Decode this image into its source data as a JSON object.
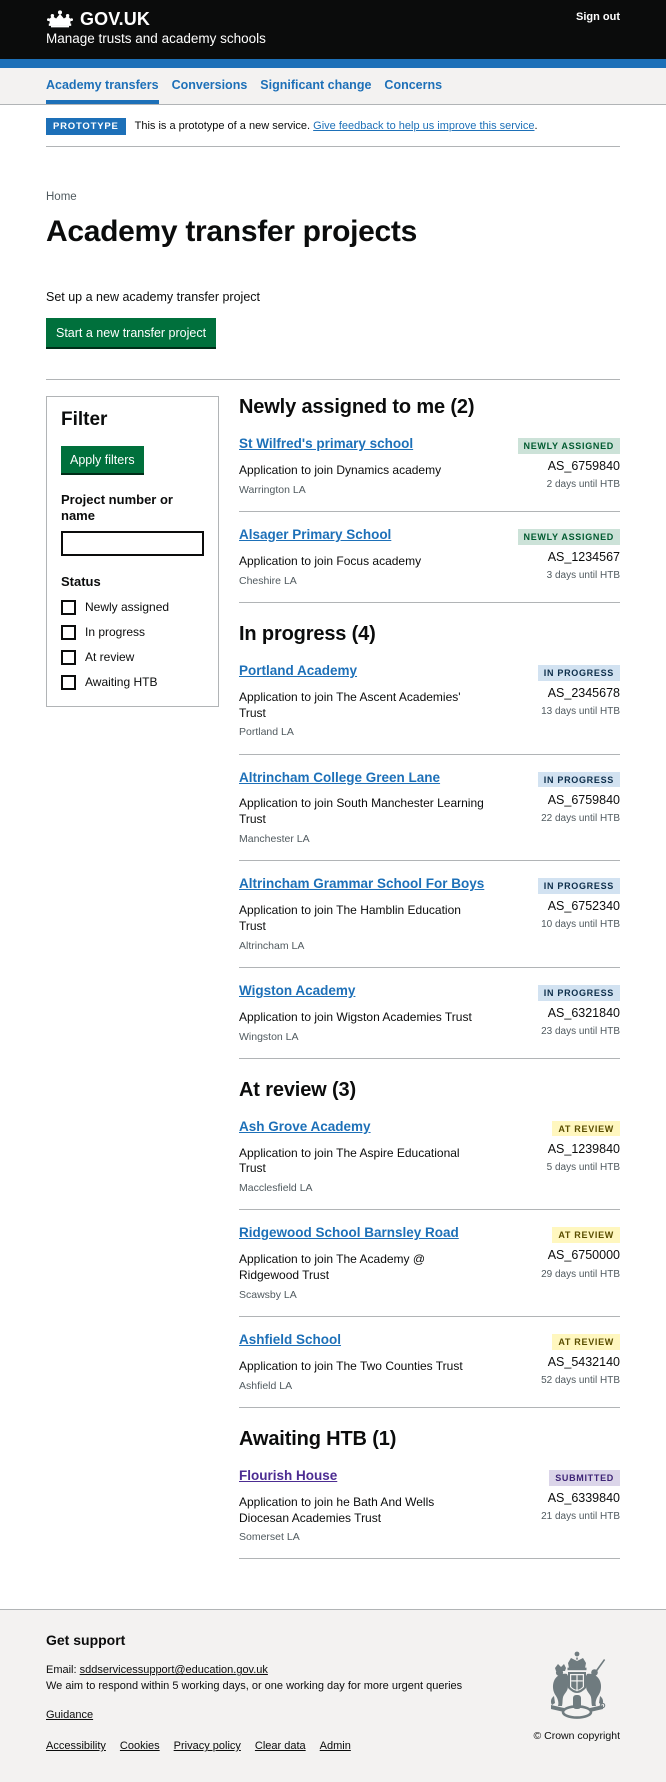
{
  "header": {
    "brand": "GOV.UK",
    "service_name": "Manage trusts and academy schools",
    "sign_out": "Sign out",
    "crown_icon": "crown-icon"
  },
  "nav": {
    "items": [
      {
        "label": "Academy transfers",
        "active": true
      },
      {
        "label": "Conversions",
        "active": false
      },
      {
        "label": "Significant change",
        "active": false
      },
      {
        "label": "Concerns",
        "active": false
      }
    ]
  },
  "phase_banner": {
    "tag": "PROTOTYPE",
    "text": "This is a prototype of a new service.",
    "link": "Give feedback to help us improve this service",
    "trailing": "."
  },
  "breadcrumb": "Home",
  "page_title": "Academy transfer projects",
  "intro": {
    "text": "Set up a new academy transfer project",
    "start_button": "Start a new transfer project"
  },
  "filter": {
    "title": "Filter",
    "apply_label": "Apply filters",
    "project_label": "Project number or name",
    "project_value": "",
    "project_placeholder": "",
    "status_label": "Status",
    "status_options": [
      {
        "label": "Newly assigned",
        "checked": false
      },
      {
        "label": "In progress",
        "checked": false
      },
      {
        "label": "At review",
        "checked": false
      },
      {
        "label": "Awaiting HTB",
        "checked": false
      }
    ]
  },
  "sections": [
    {
      "title": "Newly assigned to me (2)",
      "projects": [
        {
          "name": "St Wilfred's primary school",
          "description": "Application to join Dynamics academy",
          "la": "Warrington LA",
          "status": "NEWLY ASSIGNED",
          "status_style": "tag-green",
          "reference": "AS_6759840",
          "due": "2 days until HTB"
        },
        {
          "name": "Alsager Primary School",
          "description": "Application to join Focus academy",
          "la": "Cheshire LA",
          "status": "NEWLY ASSIGNED",
          "status_style": "tag-green",
          "reference": "AS_1234567",
          "due": "3 days until HTB"
        }
      ]
    },
    {
      "title": "In progress (4)",
      "projects": [
        {
          "name": "Portland Academy",
          "description": "Application to join The Ascent Academies' Trust",
          "la": "Portland LA",
          "status": "IN PROGRESS",
          "status_style": "tag-blue",
          "reference": "AS_2345678",
          "due": "13 days until HTB"
        },
        {
          "name": "Altrincham College Green Lane",
          "description": "Application to join South Manchester Learning Trust",
          "la": "Manchester LA",
          "status": "IN PROGRESS",
          "status_style": "tag-blue",
          "reference": "AS_6759840",
          "due": "22 days until HTB"
        },
        {
          "name": "Altrincham Grammar School For Boys",
          "description": "Application to join The Hamblin Education Trust",
          "la": "Altrincham LA",
          "status": "IN PROGRESS",
          "status_style": "tag-blue",
          "reference": "AS_6752340",
          "due": "10 days until HTB"
        },
        {
          "name": "Wigston Academy",
          "description": "Application to join Wigston Academies Trust",
          "la": "Wingston LA",
          "status": "IN PROGRESS",
          "status_style": "tag-blue",
          "reference": "AS_6321840",
          "due": "23 days until HTB"
        }
      ]
    },
    {
      "title": "At review (3)",
      "projects": [
        {
          "name": "Ash Grove Academy",
          "description": "Application to join The Aspire Educational Trust",
          "la": "Macclesfield LA",
          "status": "AT REVIEW",
          "status_style": "tag-yellow",
          "reference": "AS_1239840",
          "due": "5 days until HTB"
        },
        {
          "name": "Ridgewood School Barnsley Road",
          "description": "Application to join The Academy @ Ridgewood Trust",
          "la": "Scawsby LA",
          "status": "AT REVIEW",
          "status_style": "tag-yellow",
          "reference": "AS_6750000",
          "due": "29 days until HTB"
        },
        {
          "name": "Ashfield School",
          "description": "Application to join The Two Counties Trust",
          "la": "Ashfield LA",
          "status": "AT REVIEW",
          "status_style": "tag-yellow",
          "reference": "AS_5432140",
          "due": "52 days until HTB"
        }
      ]
    },
    {
      "title": "Awaiting HTB (1)",
      "projects": [
        {
          "name": "Flourish House",
          "description": "Application to join he Bath And Wells Diocesan Academies Trust",
          "la": "Somerset LA",
          "status": "SUBMITTED",
          "status_style": "tag-purple",
          "reference": "AS_6339840",
          "due": "21 days until HTB"
        }
      ]
    }
  ],
  "footer": {
    "title": "Get support",
    "email_prefix": "Email:",
    "email": "sddservicessupport@education.gov.uk",
    "response_note": "We aim to respond within 5 working days, or one working day for more urgent queries",
    "guidance": "Guidance",
    "links": [
      "Accessibility",
      "Cookies",
      "Privacy policy",
      "Clear data",
      "Admin"
    ],
    "copyright": "© Crown copyright",
    "crest_icon": "royal-coat-of-arms-icon"
  },
  "colors": {
    "brand_black": "#0b0c0c",
    "link_blue": "#1d70b8",
    "button_green": "#00703c",
    "grey_border": "#b1b4b6",
    "muted_text": "#505a5f",
    "panel_grey": "#f3f2f1",
    "visited_purple": "#4c2c92"
  }
}
